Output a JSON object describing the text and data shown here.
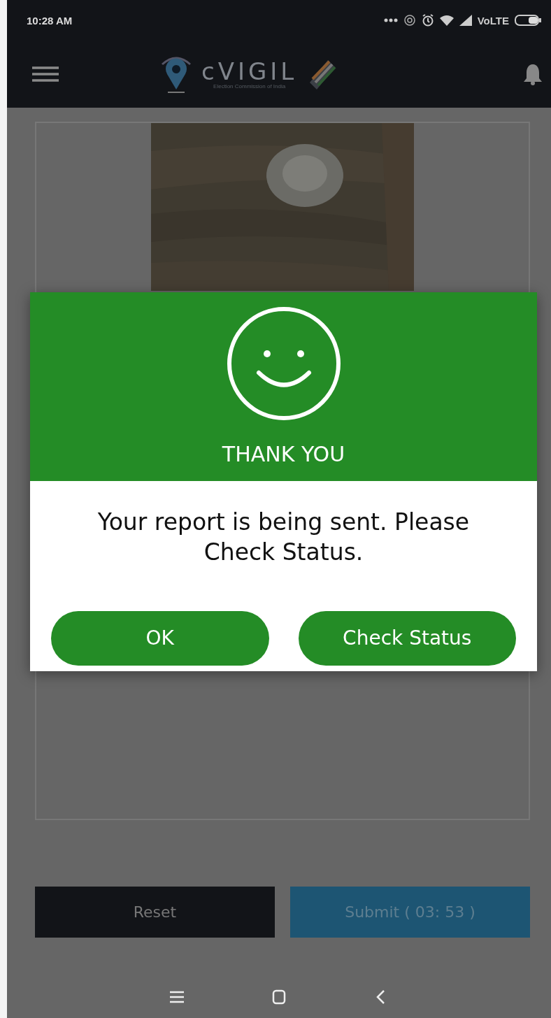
{
  "status_bar": {
    "time": "10:28 AM",
    "network": "VoLTE"
  },
  "app_bar": {
    "title": "cVIGIL",
    "subtitle": "Election Commission of India"
  },
  "dialog": {
    "title": "THANK YOU",
    "message": "Your report is being sent. Please Check Status.",
    "buttons": [
      "OK",
      "Check Status"
    ]
  },
  "actions": [
    {
      "label": "Reset",
      "kind": "reset"
    },
    {
      "label": "Submit ( 03: 53 )",
      "kind": "submit"
    }
  ]
}
